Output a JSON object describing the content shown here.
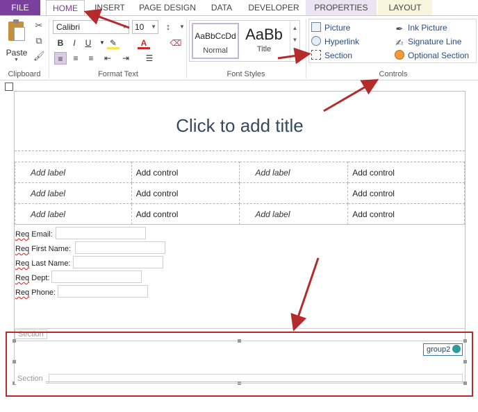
{
  "tabs": {
    "file": "FILE",
    "home": "HOME",
    "insert": "INSERT",
    "page_design": "PAGE DESIGN",
    "data": "DATA",
    "developer": "DEVELOPER",
    "properties": "PROPERTIES",
    "layout": "LAYOUT"
  },
  "ribbon": {
    "clipboard": {
      "paste_label": "Paste",
      "group_label": "Clipboard"
    },
    "format_text": {
      "font_name": "Calibri",
      "font_size": "10",
      "group_label": "Format Text"
    },
    "font_styles": {
      "normal_sample": "AaBbCcDd",
      "normal_name": "Normal",
      "title_sample": "AaBb",
      "title_name": "Title",
      "group_label": "Font Styles"
    },
    "controls": {
      "picture": "Picture",
      "hyperlink": "Hyperlink",
      "section": "Section",
      "ink_picture": "Ink Picture",
      "signature_line": "Signature Line",
      "optional_section": "Optional Section",
      "group_label": "Controls"
    }
  },
  "form": {
    "title_placeholder": "Click to add title",
    "table_rows": [
      [
        "Add label",
        "Add control",
        "Add label",
        "Add control"
      ],
      [
        "Add label",
        "Add control",
        "",
        "Add control"
      ],
      [
        "Add label",
        "Add control",
        "Add label",
        "Add control"
      ]
    ],
    "fields": [
      {
        "req": "Req",
        "label": " Email:"
      },
      {
        "req": "Req",
        "label": " First Name:"
      },
      {
        "req": "Req",
        "label": " Last Name:"
      },
      {
        "req": "Req",
        "label": " Dept:"
      },
      {
        "req": "Req",
        "label": " Phone:"
      }
    ],
    "section_tag_1": "Section",
    "section_tag_2": "Section",
    "group_tag": "group2"
  },
  "colors": {
    "file_tab": "#7b3f9e",
    "accent": "#7b3f9e",
    "annotation_arrow": "#b52a2a"
  }
}
